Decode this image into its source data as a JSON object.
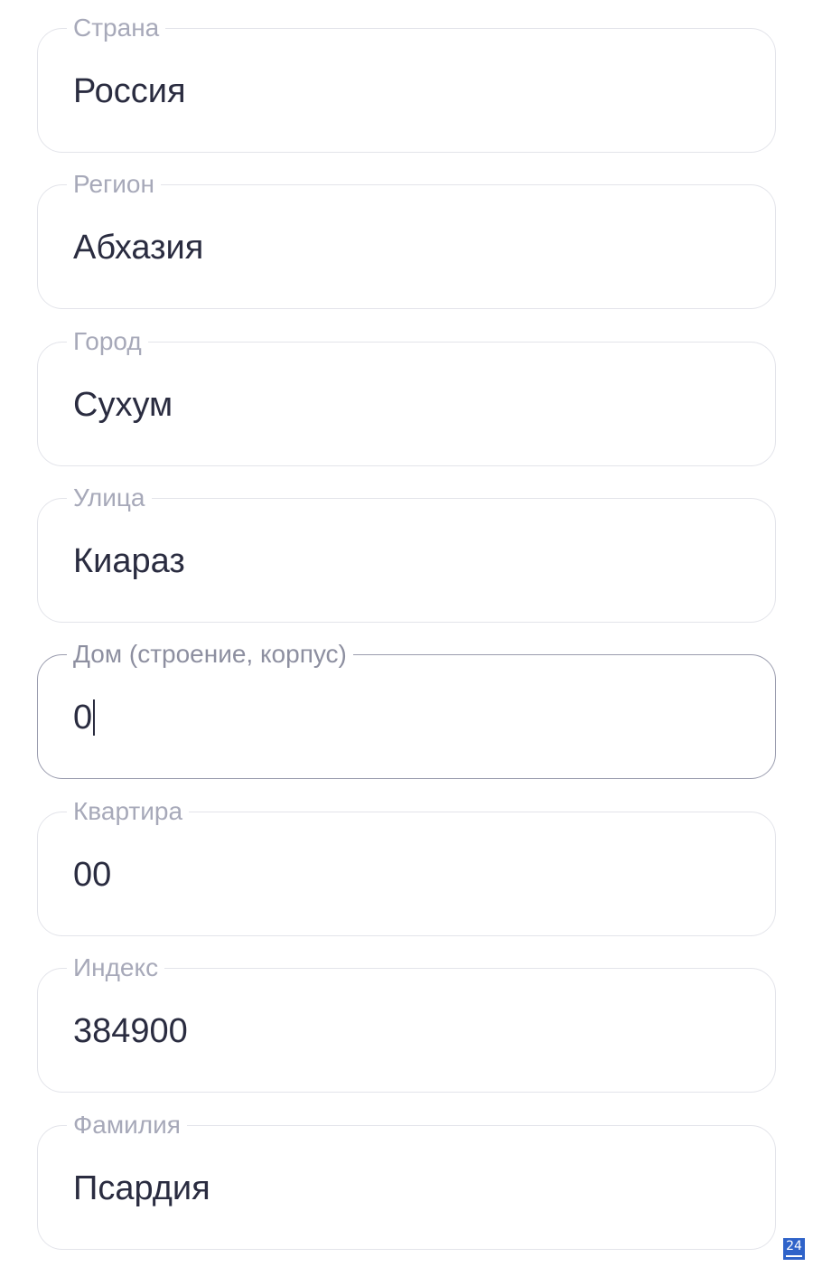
{
  "form": {
    "fields": [
      {
        "label": "Страна",
        "value": "Россия"
      },
      {
        "label": "Регион",
        "value": "Абхазия"
      },
      {
        "label": "Город",
        "value": "Сухум"
      },
      {
        "label": "Улица",
        "value": "Киараз"
      },
      {
        "label": "Дом (строение, корпус)",
        "value": "0"
      },
      {
        "label": "Квартира",
        "value": "00"
      },
      {
        "label": "Индекс",
        "value": "384900"
      },
      {
        "label": "Фамилия",
        "value": "Псардия"
      }
    ]
  },
  "badge": {
    "text": "24",
    "color": "#2f63c9"
  },
  "colors": {
    "border": "#e3e4ea",
    "border_focused": "#9a9cae",
    "label": "#a7a9b9",
    "value": "#2a2c40"
  }
}
